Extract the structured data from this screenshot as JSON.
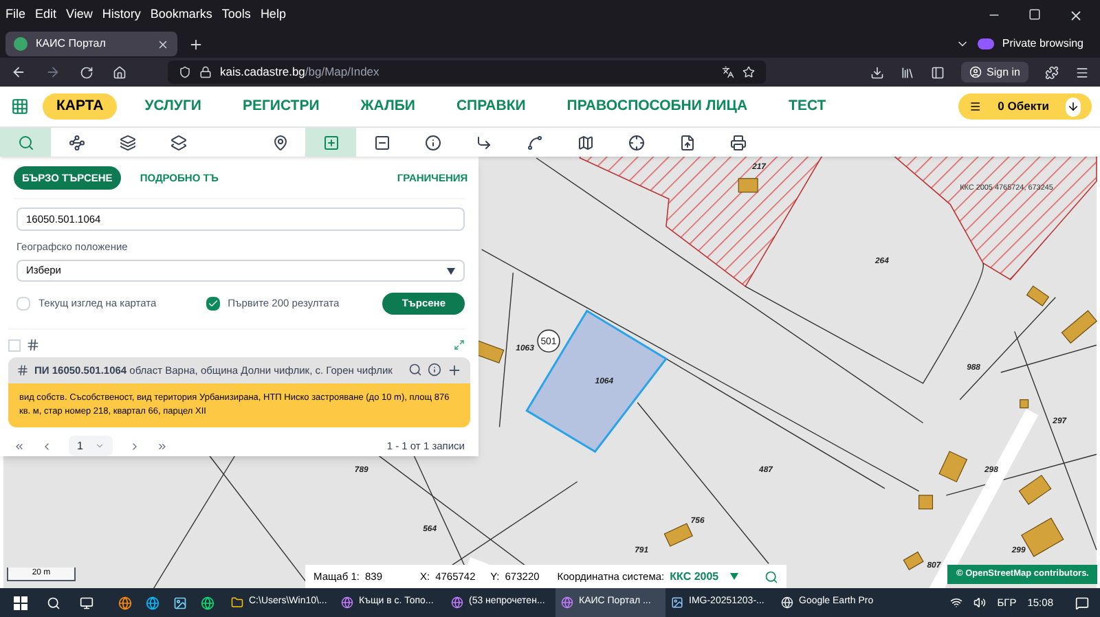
{
  "browser": {
    "menu": [
      "File",
      "Edit",
      "View",
      "History",
      "Bookmarks",
      "Tools",
      "Help"
    ],
    "tab_title": "КАИС Портал",
    "url_host": "kais.cadastre.bg",
    "url_path": "/bg/Map/Index",
    "private_label": "Private browsing",
    "sign_in": "Sign in"
  },
  "site_nav": {
    "items": [
      {
        "label": "КАРТА",
        "selected": true
      },
      {
        "label": "УСЛУГИ",
        "selected": false
      },
      {
        "label": "РЕГИСТРИ",
        "selected": false
      },
      {
        "label": "ЖАЛБИ",
        "selected": false
      },
      {
        "label": "СПРАВКИ",
        "selected": false
      },
      {
        "label": "ПРАВОСПОСОБНИ ЛИЦА",
        "selected": false
      },
      {
        "label": "ТЕСТ",
        "selected": false
      }
    ],
    "objects_label": "0 Обекти"
  },
  "toolbar": {
    "tools": [
      {
        "kind": "search",
        "selected": true
      },
      {
        "kind": "route",
        "selected": false
      },
      {
        "kind": "layers",
        "selected": false
      },
      {
        "kind": "stack",
        "selected": false
      },
      {
        "kind": "pin",
        "selected": false
      },
      {
        "kind": "select-add",
        "selected": true
      },
      {
        "kind": "select-remove",
        "selected": false
      },
      {
        "kind": "info",
        "selected": false
      },
      {
        "kind": "corner",
        "selected": false
      },
      {
        "kind": "shape",
        "selected": false
      },
      {
        "kind": "map",
        "selected": false
      },
      {
        "kind": "split",
        "selected": false
      },
      {
        "kind": "file",
        "selected": false
      },
      {
        "kind": "print",
        "selected": false
      }
    ]
  },
  "search_panel": {
    "tabs": [
      {
        "label": "БЪРЗО ТЪРСЕНЕ",
        "selected": true
      },
      {
        "label": "ПОДРОБНО ТЪ",
        "selected": false
      },
      {
        "label": "ГРАНИЧЕНИЯ",
        "selected": false
      }
    ],
    "query": "16050.501.1064",
    "location_label": "Географско положение",
    "location_value": "Избери",
    "options": [
      {
        "label": "Текущ изглед на картата",
        "checked": false
      },
      {
        "label": "Първите 200 резултата",
        "checked": true
      }
    ],
    "search_button": "Търсене",
    "select_all_checked": false,
    "result": {
      "title": "**ПИ 16050.501.1064** област Варна, община Долни чифлик, с. Горен чифлик",
      "details": "вид собств. Съсобственост, вид територия Урбанизирана, НТП Ниско застрояване (до 10 m), площ 876 кв. м, стар номер 218, квартал 66, парцел XII"
    },
    "pager": {
      "page": "1",
      "summary": "1 - 1 от 1 записи"
    }
  },
  "map": {
    "labels": [
      "217",
      "264",
      "1063",
      "988",
      "1064",
      "297",
      "789",
      "487",
      "298",
      "756",
      "564",
      "791",
      "299",
      "807"
    ],
    "district": "501",
    "coords_note": "ККС 2005 4765724, 673245",
    "scale": "20 m",
    "attribution": "© OpenStreetMap contributors."
  },
  "status": {
    "scale_label": "Мащаб 1:",
    "scale_value": "839",
    "x_label": "X:",
    "x_value": "4765742",
    "y_label": "Y:",
    "y_value": "673220",
    "system_label": "Координатна система:",
    "system_value": "ККС 2005"
  },
  "taskbar": {
    "apps": [
      {
        "label": "C:\\Users\\Win10\\...",
        "kind": "folder",
        "selected": false
      },
      {
        "label": "Къщи в с. Топо...",
        "kind": "browser",
        "selected": false
      },
      {
        "label": "(53 непрочетен...",
        "kind": "browser",
        "selected": false
      },
      {
        "label": "КАИС Портал ...",
        "kind": "browser",
        "selected": true
      },
      {
        "label": "IMG-20251203-...",
        "kind": "image",
        "selected": false
      },
      {
        "label": "Google Earth Pro",
        "kind": "earth",
        "selected": false
      }
    ],
    "language": "БГР",
    "time": "15:08"
  }
}
